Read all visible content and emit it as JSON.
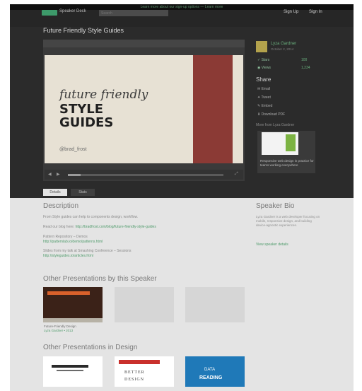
{
  "top_banner": {
    "text": "Learn more about our sign-up options — Learn more"
  },
  "navbar": {
    "brand": "Speaker Deck",
    "search_placeholder": "Search",
    "sign_up": "Sign Up",
    "sign_in": "Sign In"
  },
  "presentation": {
    "title": "Future Friendly Style Guides",
    "slide": {
      "line1": "future friendly",
      "line2": "STYLE",
      "line3": "GUIDES",
      "handle": "@brad_frost"
    }
  },
  "player": {
    "prev": "◀",
    "next": "▶",
    "fullscreen": "⤢"
  },
  "sidebar": {
    "speaker_name": "Lyza Gardner",
    "speaker_sub": "October 2, 2014",
    "rows": [
      {
        "label": "✓ Stars",
        "count": "100"
      },
      {
        "label": "◉ Views",
        "count": "1,234"
      }
    ],
    "share_heading": "Share",
    "share_items": [
      "✉ Email",
      "✦ Tweet",
      "✎ Embed",
      "⬇ Download PDF"
    ],
    "more_text": "More from Lyza Gardner",
    "more_caption": "Responsive web design in practice for teams working everywhere"
  },
  "tabs": {
    "details": "Details",
    "stats": "Stats"
  },
  "description": {
    "heading": "Description",
    "line1": "From Style guides can help to components design, workflow.",
    "line2_prefix": "Read our blog here:",
    "line2_link": "http://bradfrost.com/blog/future-friendly-style-guides",
    "line3": "Pattern Repository – Demos",
    "line3_link": "http://patternlab.io/demo/patterns.html",
    "line4": "Slides from my talk at Smashing Conference – Sessions",
    "line4_link": "http://styleguides.io/articles.html"
  },
  "speaker_bio": {
    "heading": "Speaker Bio",
    "text": "Lyza Gardner is a web developer focusing on mobile, responsive design, and building device-agnostic experiences.",
    "link": "View speaker details"
  },
  "other_by_speaker": {
    "heading": "Other Presentations by this Speaker",
    "first_caption": "Future-Friendly Design",
    "first_sub": "Lyza Gardner • 2013"
  },
  "other_in_design": {
    "heading": "Other Presentations in Design",
    "t2_line1": "BETTER",
    "t2_line2": "DESIGN",
    "t3_line1": "DATA",
    "t3_line2": "READING"
  }
}
